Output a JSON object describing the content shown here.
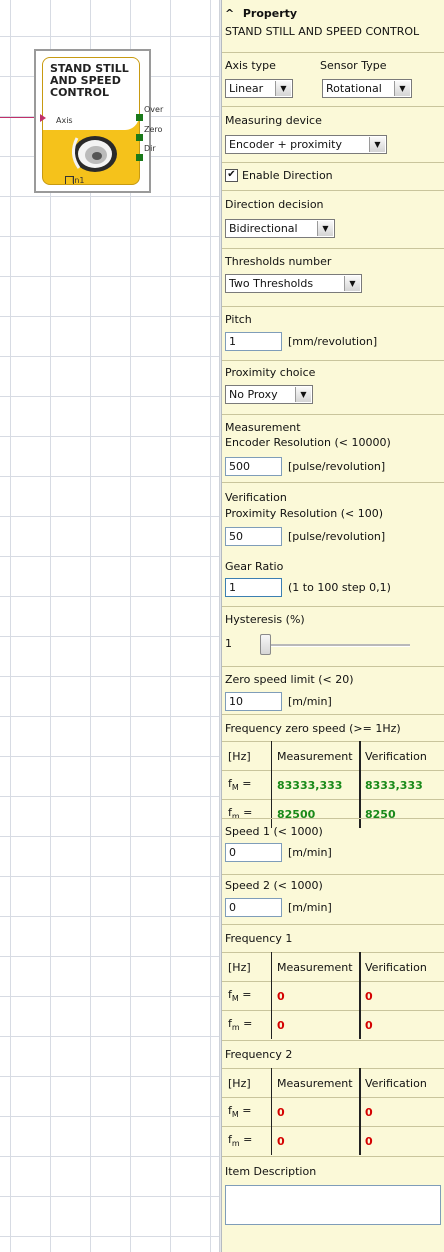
{
  "block": {
    "title_lines": [
      "STAND STILL",
      "AND SPEED",
      "CONTROL"
    ],
    "input_axis": "Axis",
    "outputs": [
      "Over",
      "Zero",
      "Dir"
    ],
    "bottom_label": "In1"
  },
  "panel": {
    "header": "Property",
    "header_chevron": "^",
    "subtitle": "STAND STILL AND SPEED CONTROL",
    "axis_type": {
      "label": "Axis type",
      "value": "Linear"
    },
    "sensor_type": {
      "label": "Sensor Type",
      "value": "Rotational"
    },
    "measuring_device": {
      "label": "Measuring device",
      "value": "Encoder + proximity"
    },
    "enable_direction": {
      "label": "Enable Direction",
      "checked": true
    },
    "direction_decision": {
      "label": "Direction decision",
      "value": "Bidirectional"
    },
    "thresholds_number": {
      "label": "Thresholds number",
      "value": "Two Thresholds"
    },
    "pitch": {
      "label": "Pitch",
      "value": "1",
      "unit": "[mm/revolution]"
    },
    "proximity_choice": {
      "label": "Proximity choice",
      "value": "No Proxy"
    },
    "measurement": {
      "label": "Measurement",
      "sublabel": "Encoder Resolution  (< 10000)",
      "value": "500",
      "unit": "[pulse/revolution]"
    },
    "verification": {
      "label": "Verification",
      "sublabel": "Proximity Resolution  (< 100)",
      "value": "50",
      "unit": "[pulse/revolution]"
    },
    "gear_ratio": {
      "label": "Gear Ratio",
      "value": "1",
      "unit": "(1 to 100 step 0,1)"
    },
    "hysteresis": {
      "label": "Hysteresis (%)",
      "value": "1",
      "slider_level": 0.0
    },
    "zero_speed_limit": {
      "label": "Zero speed limit  (< 20)",
      "value": "10",
      "unit": "[m/min]"
    },
    "freq_zero": {
      "label": "Frequency zero speed (>= 1Hz)",
      "header": [
        "[Hz]",
        "Measurement",
        "Verification"
      ],
      "rows": [
        {
          "f": "f",
          "sub": "M",
          "eq": " =",
          "meas": "83333,333",
          "ver": "8333,333"
        },
        {
          "f": "f",
          "sub": "m",
          "eq": " =",
          "meas": "82500",
          "ver": "8250"
        }
      ]
    },
    "speed1": {
      "label": "Speed 1  (< 1000)",
      "value": "0",
      "unit": "[m/min]"
    },
    "speed2": {
      "label": "Speed 2  (< 1000)",
      "value": "0",
      "unit": "[m/min]"
    },
    "freq1": {
      "label": "Frequency 1",
      "header": [
        "[Hz]",
        "Measurement",
        "Verification"
      ],
      "rows": [
        {
          "f": "f",
          "sub": "M",
          "eq": " =",
          "meas": "0",
          "ver": "0"
        },
        {
          "f": "f",
          "sub": "m",
          "eq": " =",
          "meas": "0",
          "ver": "0"
        }
      ]
    },
    "freq2": {
      "label": "Frequency 2",
      "header": [
        "[Hz]",
        "Measurement",
        "Verification"
      ],
      "rows": [
        {
          "f": "f",
          "sub": "M",
          "eq": " =",
          "meas": "0",
          "ver": "0"
        },
        {
          "f": "f",
          "sub": "m",
          "eq": " =",
          "meas": "0",
          "ver": "0"
        }
      ]
    },
    "item_description": {
      "label": "Item Description",
      "value": ""
    }
  },
  "colors": {
    "panel_bg": "#fbf9d8",
    "block_bg": "#f5c21b",
    "ok_value": "#1a8a1a",
    "alarm_value": "#d40000"
  }
}
